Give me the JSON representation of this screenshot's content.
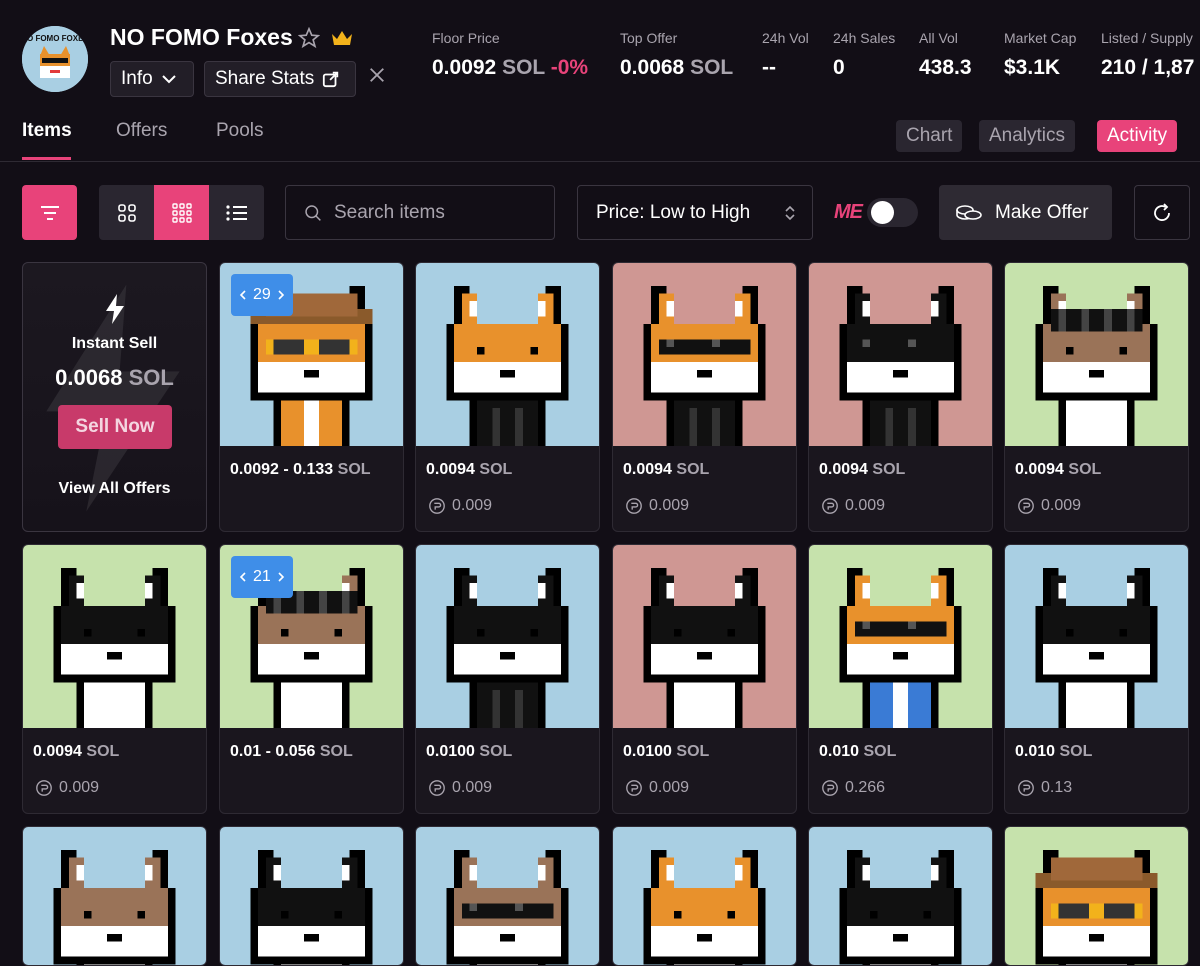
{
  "collection": {
    "title": "NO FOMO Foxes",
    "logo_text": "NO FOMO FOXES",
    "info_label": "Info",
    "share_label": "Share Stats",
    "social_icon": "x-icon"
  },
  "stats": [
    {
      "label": "Floor Price",
      "value": "0.0092",
      "unit": "SOL",
      "change": "-0%"
    },
    {
      "label": "Top Offer",
      "value": "0.0068",
      "unit": "SOL"
    },
    {
      "label": "24h Vol",
      "value": "--"
    },
    {
      "label": "24h Sales",
      "value": "0"
    },
    {
      "label": "All Vol",
      "value": "438.3"
    },
    {
      "label": "Market Cap",
      "value": "$3.1K"
    },
    {
      "label": "Listed / Supply",
      "value": "210 / 1,87"
    }
  ],
  "tabs": {
    "items": "Items",
    "offers": "Offers",
    "pools": "Pools"
  },
  "right_tabs": {
    "chart": "Chart",
    "analytics": "Analytics",
    "activity": "Activity"
  },
  "toolbar": {
    "search_placeholder": "Search items",
    "sort_label": "Price: Low to High",
    "make_offer_label": "Make Offer",
    "me_logo": "ME"
  },
  "instant_sell": {
    "title": "Instant Sell",
    "price": "0.0068",
    "unit": "SOL",
    "button": "Sell Now",
    "link": "View All Offers"
  },
  "cards": [
    {
      "price": "0.0092 - 0.133",
      "unit": "SOL",
      "last": "",
      "badge": "29",
      "bg": "#a9cfe3",
      "fur": "#e8912c",
      "head": "hat",
      "body": "orange"
    },
    {
      "price": "0.0094",
      "unit": "SOL",
      "last": "0.009",
      "bg": "#a9cfe3",
      "fur": "#e8912c",
      "head": "none",
      "body": "black"
    },
    {
      "price": "0.0094",
      "unit": "SOL",
      "last": "0.009",
      "bg": "#cf9793",
      "fur": "#e8912c",
      "head": "shades",
      "body": "black"
    },
    {
      "price": "0.0094",
      "unit": "SOL",
      "last": "0.009",
      "bg": "#cf9793",
      "fur": "#111111",
      "head": "shades",
      "body": "black"
    },
    {
      "price": "0.0094",
      "unit": "SOL",
      "last": "0.009",
      "bg": "#c6e2ac",
      "fur": "#9a7358",
      "head": "dreads",
      "body": "white"
    },
    {
      "price": "0.0094",
      "unit": "SOL",
      "last": "0.009",
      "bg": "#c6e2ac",
      "fur": "#111111",
      "head": "none",
      "body": "white"
    },
    {
      "price": "0.01 - 0.056",
      "unit": "SOL",
      "last": "",
      "badge": "21",
      "bg": "#c6e2ac",
      "fur": "#9a7358",
      "head": "dreads",
      "body": "white"
    },
    {
      "price": "0.0100",
      "unit": "SOL",
      "last": "0.009",
      "bg": "#a9cfe3",
      "fur": "#111111",
      "head": "none",
      "body": "black"
    },
    {
      "price": "0.0100",
      "unit": "SOL",
      "last": "0.009",
      "bg": "#cf9793",
      "fur": "#111111",
      "head": "none",
      "body": "white"
    },
    {
      "price": "0.010",
      "unit": "SOL",
      "last": "0.266",
      "bg": "#c6e2ac",
      "fur": "#e8912c",
      "head": "shades",
      "body": "blue"
    },
    {
      "price": "0.010",
      "unit": "SOL",
      "last": "0.13",
      "bg": "#a9cfe3",
      "fur": "#111111",
      "head": "none",
      "body": "white"
    }
  ],
  "partial_cards": [
    {
      "bg": "#a9cfe3",
      "fur": "#9a7358",
      "head": "none"
    },
    {
      "bg": "#a9cfe3",
      "fur": "#111111",
      "head": "none"
    },
    {
      "bg": "#a9cfe3",
      "fur": "#9a7358",
      "head": "shades"
    },
    {
      "bg": "#a9cfe3",
      "fur": "#e8912c",
      "head": "none"
    },
    {
      "bg": "#a9cfe3",
      "fur": "#111111",
      "head": "none"
    },
    {
      "bg": "#c6e2ac",
      "fur": "#e8912c",
      "head": "hat"
    }
  ],
  "colors": {
    "accent": "#e8437a",
    "badge": "#3f8ee8",
    "background": "#120e16"
  }
}
